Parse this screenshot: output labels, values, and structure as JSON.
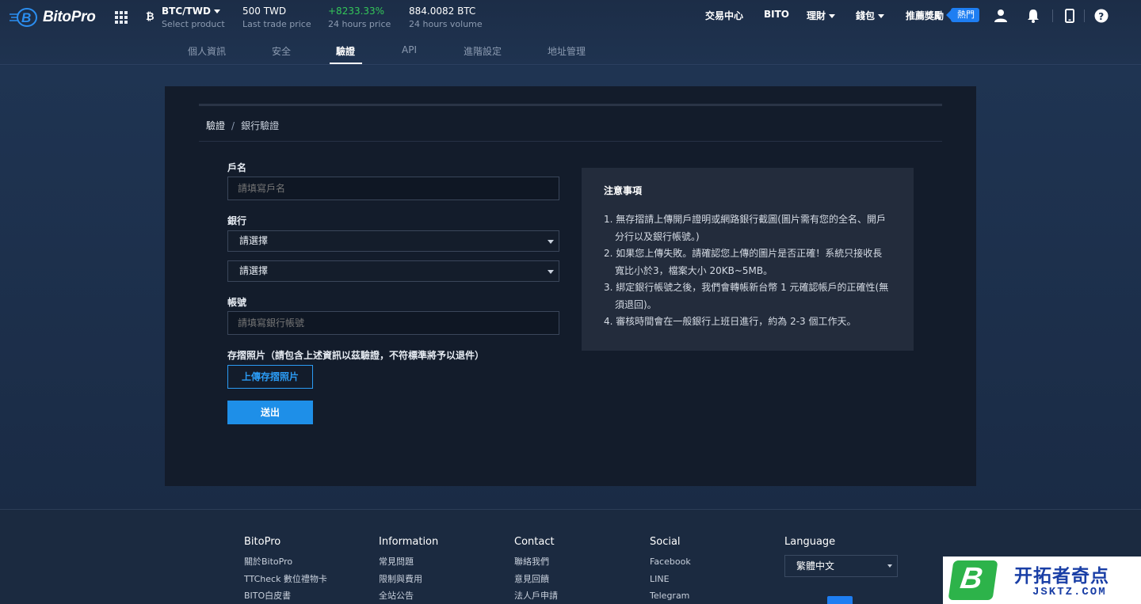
{
  "header": {
    "brand": "BitoPro",
    "pair": {
      "name": "BTC/TWD",
      "sub": "Select product"
    },
    "stats": [
      {
        "value": "500 TWD",
        "label": "Last trade price",
        "color": "#ffffff"
      },
      {
        "value": "+8233.33%",
        "label": "24 hours price",
        "color": "#34c759"
      },
      {
        "value": "884.0082 BTC",
        "label": "24 hours volume",
        "color": "#ffffff"
      }
    ],
    "nav": {
      "exchange": "交易中心",
      "bito": "BITO",
      "finance": "理財",
      "wallet": "錢包",
      "referral": "推薦獎勵",
      "hot_badge": "熱門"
    },
    "icons": [
      "user-icon",
      "bell-icon",
      "mobile-icon",
      "help-icon"
    ],
    "tabs": [
      {
        "label": "個人資訊",
        "active": false
      },
      {
        "label": "安全",
        "active": false
      },
      {
        "label": "驗證",
        "active": true
      },
      {
        "label": "API",
        "active": false
      },
      {
        "label": "進階設定",
        "active": false
      },
      {
        "label": "地址管理",
        "active": false
      }
    ]
  },
  "breadcrumb": {
    "root": "驗證",
    "sep": "/",
    "current": "銀行驗證"
  },
  "form": {
    "account_name_label": "戶名",
    "account_name_placeholder": "請填寫戶名",
    "bank_label": "銀行",
    "bank_select": "請選擇",
    "branch_select": "請選擇",
    "account_no_label": "帳號",
    "account_no_placeholder": "請填寫銀行帳號",
    "passbook_label": "存摺照片（請包含上述資訊以茲驗證，不符標準將予以退件）",
    "upload_button": "上傳存摺照片",
    "submit_button": "送出"
  },
  "notice": {
    "title": "注意事項",
    "items": [
      "1. 無存摺請上傳開戶證明或網路銀行截圖(圖片需有您的全名、開戶分行以及銀行帳號。)",
      "2. 如果您上傳失敗。請確認您上傳的圖片是否正確！系統只接收長寬比小於3，檔案大小 20KB~5MB。",
      "3. 綁定銀行帳號之後，我們會轉帳新台幣 1 元確認帳戶的正確性(無須退回)。",
      "4. 審核時間會在一般銀行上班日進行，約為 2-3 個工作天。"
    ]
  },
  "footer": {
    "columns": [
      {
        "heading": "BitoPro",
        "links": [
          "關於BitoPro",
          "TTCheck 數位禮物卡",
          "BITO白皮書"
        ]
      },
      {
        "heading": "Information",
        "links": [
          "常見問題",
          "限制與費用",
          "全站公告"
        ]
      },
      {
        "heading": "Contact",
        "links": [
          "聯絡我們",
          "意見回饋",
          "法人戶申請"
        ]
      },
      {
        "heading": "Social",
        "links": [
          "Facebook",
          "LINE",
          "Telegram"
        ]
      }
    ],
    "language_heading": "Language",
    "language_value": "繁體中文"
  },
  "watermark": {
    "logo_letter": "B",
    "text": "开拓者奇点",
    "sub": "JSKTZ.COM"
  },
  "colors": {
    "accent": "#1e8fe8",
    "positive": "#34c759",
    "panel": "#131c2b"
  }
}
